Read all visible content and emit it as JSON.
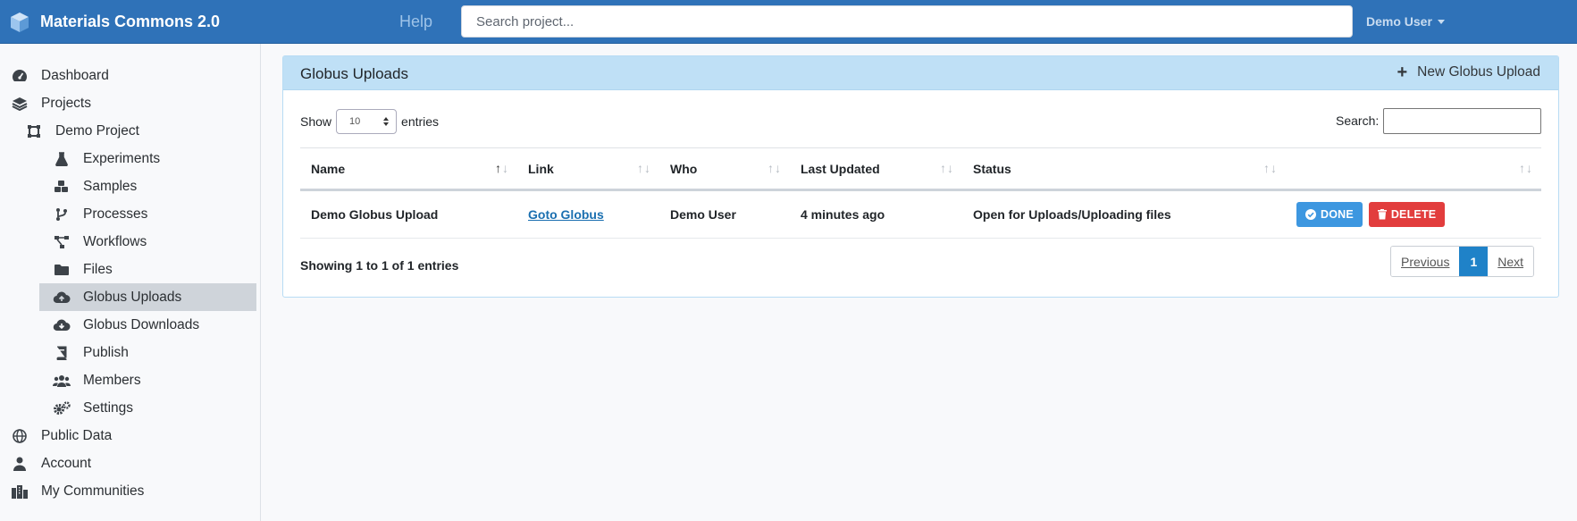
{
  "header": {
    "brand": "Materials Commons 2.0",
    "help": "Help",
    "search_placeholder": "Search project...",
    "user": "Demo User"
  },
  "sidebar": {
    "items": [
      {
        "label": "Dashboard",
        "icon": "dashboard-icon"
      },
      {
        "label": "Projects",
        "icon": "layers-icon"
      },
      {
        "label": "Demo Project",
        "icon": "project-icon"
      },
      {
        "label": "Experiments",
        "icon": "flask-icon"
      },
      {
        "label": "Samples",
        "icon": "cubes-icon"
      },
      {
        "label": "Processes",
        "icon": "branch-icon"
      },
      {
        "label": "Workflows",
        "icon": "workflow-icon"
      },
      {
        "label": "Files",
        "icon": "folder-icon"
      },
      {
        "label": "Globus Uploads",
        "icon": "cloud-upload-icon",
        "active": true
      },
      {
        "label": "Globus Downloads",
        "icon": "cloud-download-icon"
      },
      {
        "label": "Publish",
        "icon": "book-icon"
      },
      {
        "label": "Members",
        "icon": "users-icon"
      },
      {
        "label": "Settings",
        "icon": "gears-icon"
      },
      {
        "label": "Public Data",
        "icon": "globe-icon"
      },
      {
        "label": "Account",
        "icon": "user-icon"
      },
      {
        "label": "My Communities",
        "icon": "city-icon"
      }
    ]
  },
  "card": {
    "title": "Globus Uploads",
    "new_label": "New Globus Upload"
  },
  "table_controls": {
    "show": "Show",
    "length": "10",
    "entries": "entries",
    "search_label": "Search:"
  },
  "table": {
    "columns": [
      "Name",
      "Link",
      "Who",
      "Last Updated",
      "Status",
      ""
    ],
    "rows": [
      {
        "name": "Demo Globus Upload",
        "link": "Goto Globus",
        "who": "Demo User",
        "updated": "4 minutes ago",
        "status": "Open for Uploads/Uploading files",
        "done": "DONE",
        "delete": "DELETE"
      }
    ]
  },
  "footer": {
    "info": "Showing 1 to 1 of 1 entries",
    "prev": "Previous",
    "page": "1",
    "next": "Next"
  },
  "colors": {
    "topbar": "#2f72b8",
    "card_header": "#bfe0f6",
    "done": "#3d97e0",
    "delete": "#e23d3d",
    "active_nav": "#cfd4da"
  }
}
